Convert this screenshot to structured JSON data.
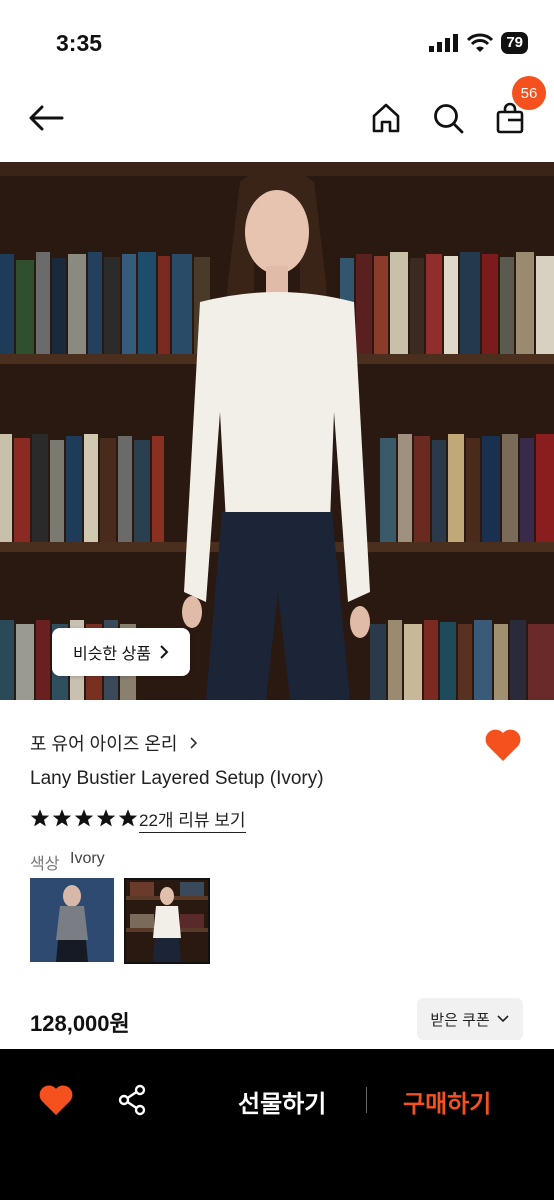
{
  "status": {
    "time": "3:35",
    "battery": "79"
  },
  "nav": {
    "cart_count": "56"
  },
  "hero": {
    "similar_label": "비슷한 상품"
  },
  "product": {
    "brand": "포 유어 아이즈 온리",
    "title": "Lany Bustier Layered Setup (Ivory)",
    "rating_stars": 5,
    "review_link": "22개 리뷰 보기",
    "color_label": "색상",
    "color_value": "Ivory",
    "price": "128,000원",
    "coupon_label": "받은 쿠폰"
  },
  "bottom": {
    "gift_label": "선물하기",
    "buy_label": "구매하기"
  },
  "colors": {
    "accent": "#f4511e",
    "heart": "#f4511e",
    "bar_bg": "#000000"
  }
}
